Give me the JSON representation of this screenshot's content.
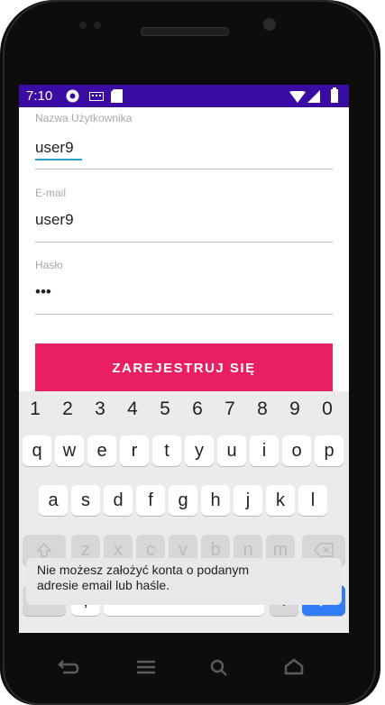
{
  "status_bar": {
    "time": "7:10"
  },
  "form": {
    "username_label": "Nazwa Użytkownika",
    "username_value": "user9",
    "email_label": "E-mail",
    "email_value": "user9",
    "password_label": "Hasło",
    "password_value": "•••",
    "register_button": "ZAREJESTRUJ SIĘ"
  },
  "keyboard": {
    "number_row": [
      "1",
      "2",
      "3",
      "4",
      "5",
      "6",
      "7",
      "8",
      "9",
      "0"
    ],
    "row1": [
      "q",
      "w",
      "e",
      "r",
      "t",
      "y",
      "u",
      "i",
      "o",
      "p"
    ],
    "row2": [
      "a",
      "s",
      "d",
      "f",
      "g",
      "h",
      "j",
      "k",
      "l"
    ],
    "row3": [
      "z",
      "x",
      "c",
      "v",
      "b",
      "n",
      "m"
    ],
    "symbols_key": "?123",
    "comma_key": ",",
    "period_key": "."
  },
  "toast": {
    "message_line1": "Nie możesz założyć konta o podanym",
    "message_line2": "adresie email lub haśle."
  },
  "colors": {
    "status_bar": "#3a0ca3",
    "accent": "#e91e63",
    "focus_underline": "#2aa1c5"
  }
}
